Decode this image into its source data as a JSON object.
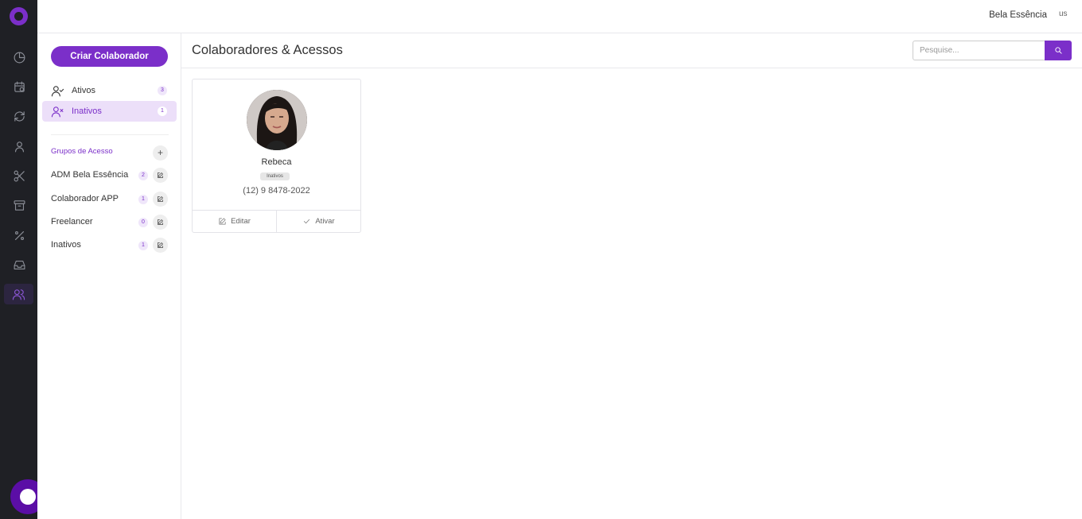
{
  "topbar": {
    "company_name": "Bela Essência",
    "user_image_alt": "us"
  },
  "rail": {
    "icons": [
      "clock-chart-icon",
      "calendar-icon",
      "refresh-icon",
      "user-icon",
      "scissors-icon",
      "archive-icon",
      "percent-icon",
      "inbox-icon",
      "users-icon"
    ],
    "active_icon": "users-icon"
  },
  "sidebar": {
    "create_button": "Criar Colaborador",
    "nav": [
      {
        "label": "Ativos",
        "count": "3",
        "icon": "user-check-icon"
      },
      {
        "label": "Inativos",
        "count": "1",
        "icon": "user-x-icon"
      }
    ],
    "groups_title": "Grupos de Acesso",
    "add_group_label": "+",
    "groups": [
      {
        "label": "ADM Bela Essência",
        "count": "2"
      },
      {
        "label": "Colaborador APP",
        "count": "1"
      },
      {
        "label": "Freelancer",
        "count": "0"
      },
      {
        "label": "Inativos",
        "count": "1"
      }
    ]
  },
  "main": {
    "title": "Colaboradores & Acessos",
    "search_placeholder": "Pesquise...",
    "cards": [
      {
        "name": "Rebeca",
        "status": "Inativos",
        "phone": "(12) 9 8478-2022",
        "edit_label": "Editar",
        "activate_label": "Ativar"
      }
    ]
  },
  "colors": {
    "accent": "#7b2fc9",
    "rail_bg": "#1f2025",
    "active_nav_bg": "#ecdff9"
  }
}
